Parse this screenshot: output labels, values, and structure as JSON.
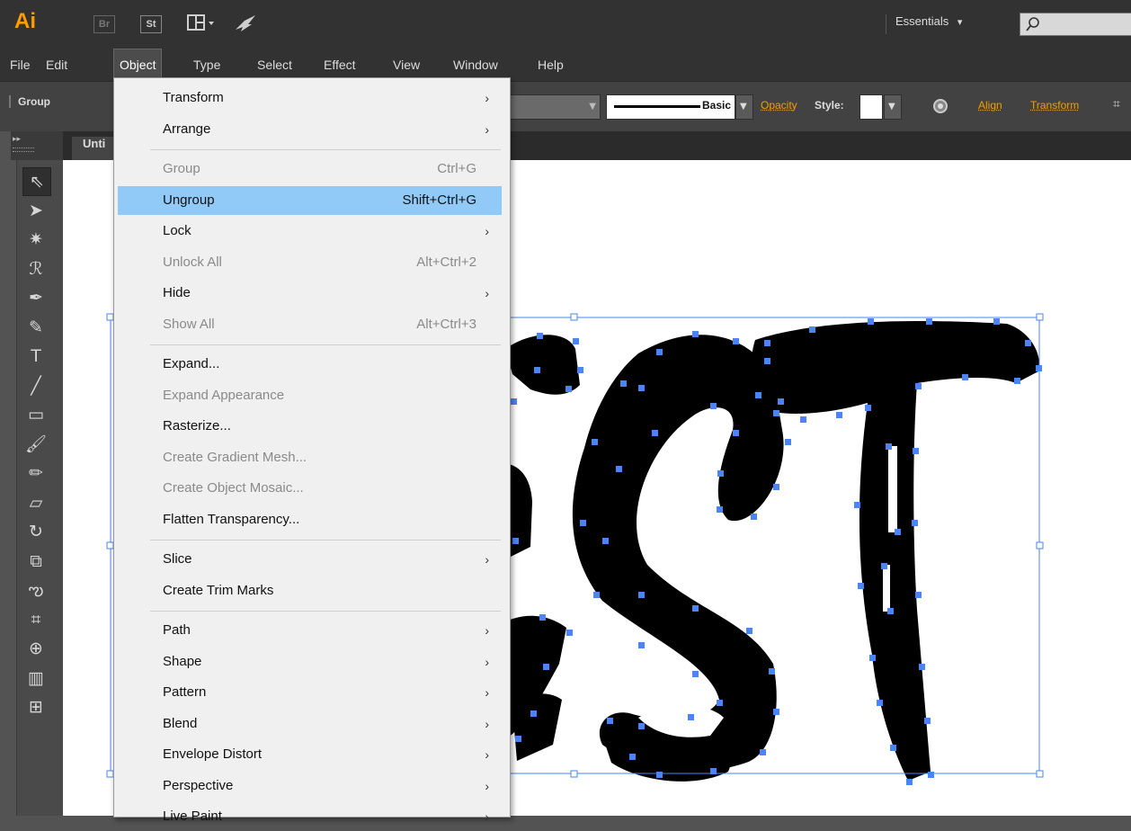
{
  "appbar": {
    "logo": "Ai",
    "br": "Br",
    "st": "St",
    "workspace": "Essentials",
    "workspace_arrow": "▾"
  },
  "menubar": {
    "items": [
      "File",
      "Edit",
      "Object",
      "Type",
      "Select",
      "Effect",
      "View",
      "Window",
      "Help"
    ]
  },
  "control": {
    "selection_label": "Group",
    "stroke_profile": "Basic",
    "opacity": "Opacity",
    "style": "Style:",
    "align": "Align",
    "transform": "Transform"
  },
  "document": {
    "tab_label": "Unti"
  },
  "object_menu": {
    "items": [
      {
        "label": "Transform",
        "submenu": true
      },
      {
        "label": "Arrange",
        "submenu": true
      },
      {
        "sep": true
      },
      {
        "label": "Group",
        "shortcut": "Ctrl+G",
        "disabled": true
      },
      {
        "label": "Ungroup",
        "shortcut": "Shift+Ctrl+G",
        "highlight": true
      },
      {
        "label": "Lock",
        "submenu": true
      },
      {
        "label": "Unlock All",
        "shortcut": "Alt+Ctrl+2",
        "disabled": true
      },
      {
        "label": "Hide",
        "submenu": true
      },
      {
        "label": "Show All",
        "shortcut": "Alt+Ctrl+3",
        "disabled": true
      },
      {
        "sep": true
      },
      {
        "label": "Expand..."
      },
      {
        "label": "Expand Appearance",
        "disabled": true
      },
      {
        "label": "Rasterize..."
      },
      {
        "label": "Create Gradient Mesh...",
        "disabled": true
      },
      {
        "label": "Create Object Mosaic...",
        "disabled": true
      },
      {
        "label": "Flatten Transparency..."
      },
      {
        "sep": true
      },
      {
        "label": "Slice",
        "submenu": true
      },
      {
        "label": "Create Trim Marks"
      },
      {
        "sep": true
      },
      {
        "label": "Path",
        "submenu": true
      },
      {
        "label": "Shape",
        "submenu": true
      },
      {
        "label": "Pattern",
        "submenu": true
      },
      {
        "label": "Blend",
        "submenu": true
      },
      {
        "label": "Envelope Distort",
        "submenu": true
      },
      {
        "label": "Perspective",
        "submenu": true
      },
      {
        "label": "Live Paint",
        "submenu": true
      }
    ]
  },
  "tools": [
    {
      "icon": "selection-icon",
      "glyph": "⇖"
    },
    {
      "icon": "direct-selection-icon",
      "glyph": "➤"
    },
    {
      "icon": "magic-wand-icon",
      "glyph": "✷"
    },
    {
      "icon": "lasso-icon",
      "glyph": "ℛ"
    },
    {
      "icon": "pen-icon",
      "glyph": "✒"
    },
    {
      "icon": "curvature-icon",
      "glyph": "✎"
    },
    {
      "icon": "type-icon",
      "glyph": "T"
    },
    {
      "icon": "line-segment-icon",
      "glyph": "╱"
    },
    {
      "icon": "rectangle-icon",
      "glyph": "▭"
    },
    {
      "icon": "paintbrush-icon",
      "glyph": "🖌"
    },
    {
      "icon": "pencil-icon",
      "glyph": "✏"
    },
    {
      "icon": "eraser-icon",
      "glyph": "▱"
    },
    {
      "icon": "rotate-icon",
      "glyph": "↻"
    },
    {
      "icon": "scale-icon",
      "glyph": "⧉"
    },
    {
      "icon": "warp-icon",
      "glyph": "ఌ"
    },
    {
      "icon": "free-transform-icon",
      "glyph": "⌗"
    },
    {
      "icon": "shape-builder-icon",
      "glyph": "⊕"
    },
    {
      "icon": "perspective-grid-icon",
      "glyph": "▥"
    },
    {
      "icon": "mesh-icon",
      "glyph": "⊞"
    }
  ],
  "colors": {
    "anchor": "#4a84f5",
    "menu_highlight": "#91c9f7",
    "accent_orange": "#ff9a00"
  }
}
